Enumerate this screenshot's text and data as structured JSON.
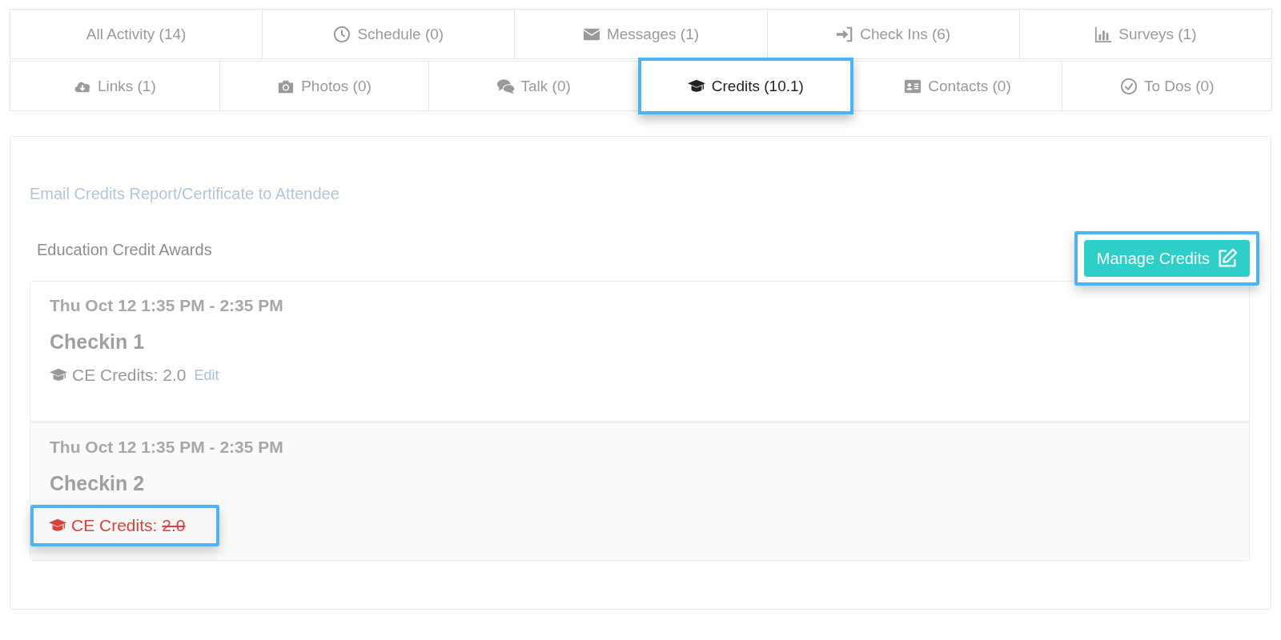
{
  "tab_rows": [
    [
      {
        "label": "All Activity (14)",
        "selected": false
      },
      {
        "label": "Schedule (0)",
        "selected": false
      },
      {
        "label": "Messages (1)",
        "selected": false
      },
      {
        "label": "Check Ins (6)",
        "selected": false
      },
      {
        "label": "Surveys (1)",
        "selected": false
      }
    ],
    [
      {
        "label": "Links (1)",
        "selected": false
      },
      {
        "label": "Photos (0)",
        "selected": false
      },
      {
        "label": "Talk (0)",
        "selected": false
      },
      {
        "label": "Credits (10.1)",
        "selected": true
      },
      {
        "label": "Contacts (0)",
        "selected": false
      },
      {
        "label": "To Dos (0)",
        "selected": false
      }
    ]
  ],
  "email_link": "Email Credits Report/Certificate to Attendee",
  "section_title": "Education Credit Awards",
  "manage_button": {
    "label": "Manage Credits",
    "highlighted": true
  },
  "awards": [
    {
      "time": "Thu Oct 12 1:35 PM - 2:35 PM",
      "title": "Checkin 1",
      "credits_label": "CE Credits:",
      "credits_value": "2.0",
      "revoked": false,
      "highlighted": false,
      "edit": "Edit"
    },
    {
      "time": "Thu Oct 12 1:35 PM - 2:35 PM",
      "title": "Checkin 2",
      "credits_label": "CE Credits:",
      "credits_value": "2.0",
      "revoked": true,
      "highlighted": true
    }
  ]
}
